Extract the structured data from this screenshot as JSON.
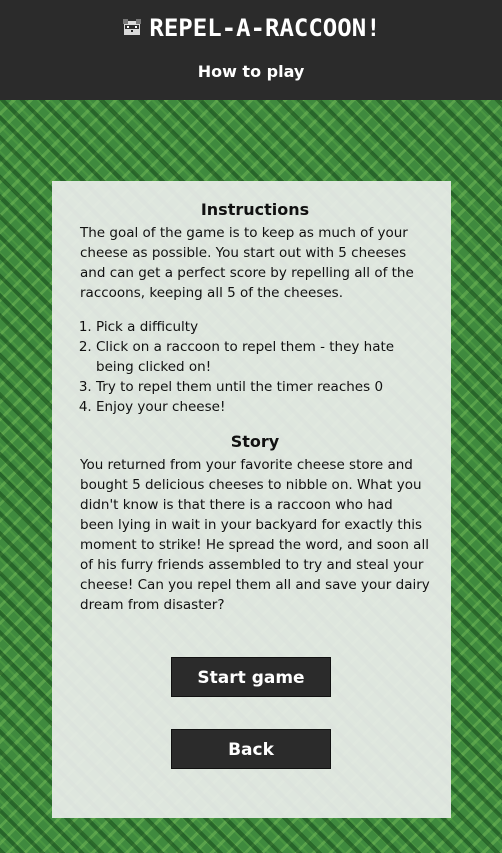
{
  "header": {
    "logo_icon": "raccoon-icon",
    "title": "REPEL-A-RACCOON!",
    "subtitle": "How to play"
  },
  "instructions": {
    "heading": "Instructions",
    "intro": "The goal of the game is to keep as much of your cheese as possible. You start out with 5 cheeses and can get a perfect score by repelling all of the raccoons, keeping all 5 of the cheeses.",
    "steps": [
      "Pick a difficulty",
      "Click on a raccoon to repel them - they hate being clicked on!",
      "Try to repel them until the timer reaches 0",
      "Enjoy your cheese!"
    ]
  },
  "story": {
    "heading": "Story",
    "text": "You returned from your favorite cheese store and bought 5 delicious cheeses to nibble on. What you didn't know is that there is a raccoon who had been lying in wait in your backyard for exactly this moment to strike! He spread the word, and soon all of his furry friends assembled to try and steal your cheese! Can you repel them all and save your dairy dream from disaster?"
  },
  "buttons": {
    "start": "Start game",
    "back": "Back"
  },
  "colors": {
    "header_bg": "#2b2b2b",
    "button_bg": "#2b2b2b",
    "background_green": "#3f8a3e"
  }
}
